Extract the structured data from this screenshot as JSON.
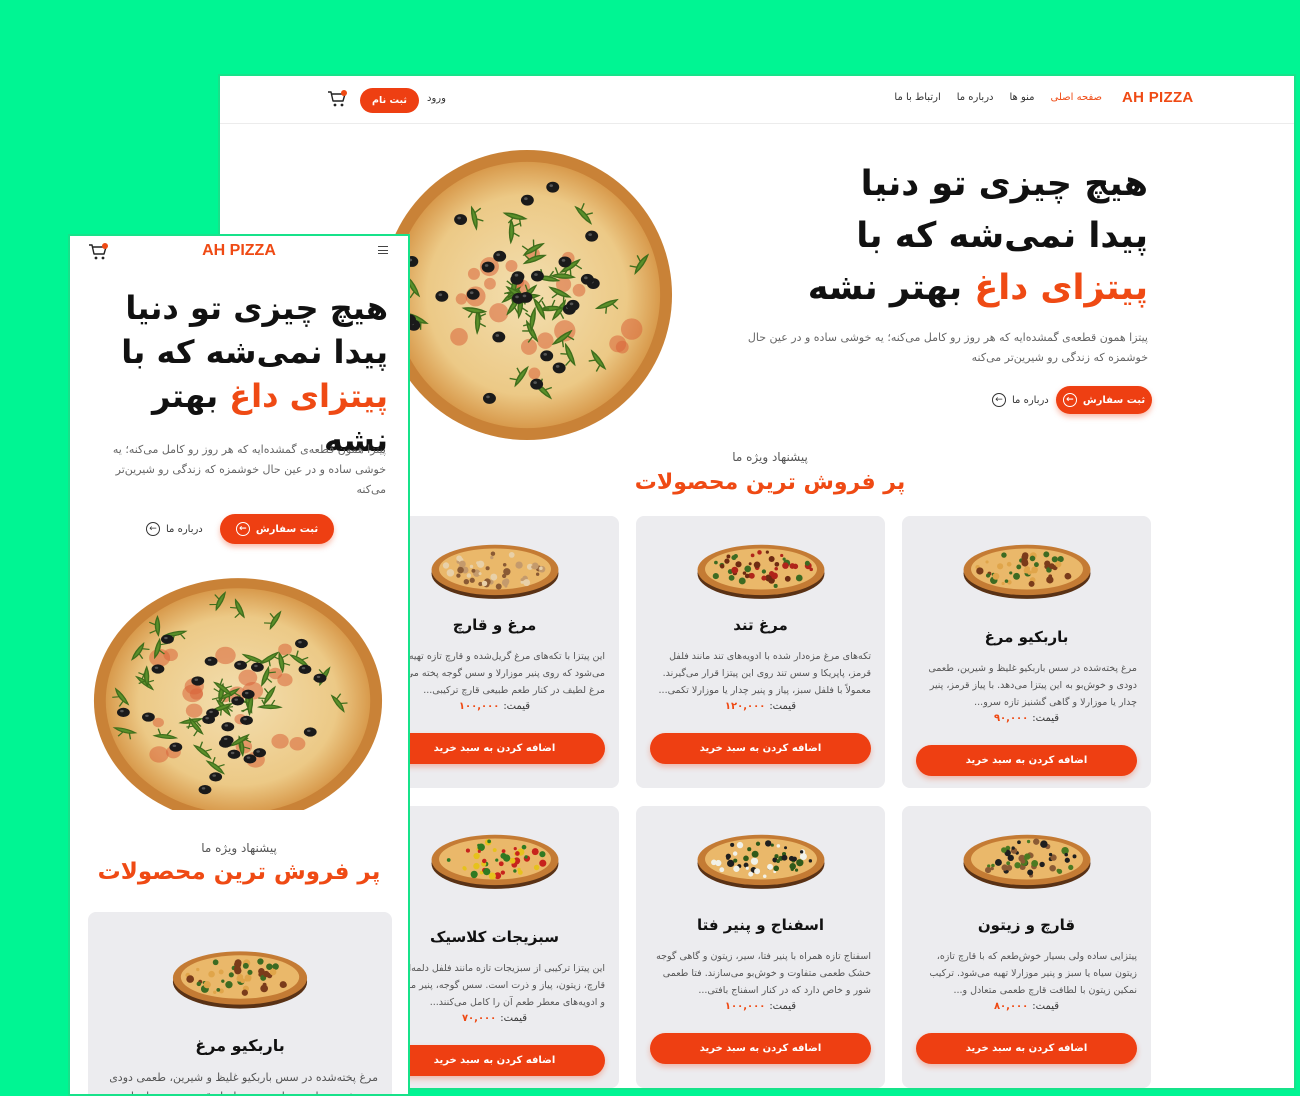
{
  "brand": "AH PIZZA",
  "colors": {
    "accent": "#ef4a14",
    "background": "#00f593",
    "card": "#ececef"
  },
  "nav": {
    "items": [
      "صفحه اصلی",
      "منو ها",
      "درباره ما",
      "ارتباط با ما"
    ],
    "login": "ورود",
    "signup": "ثبت نام",
    "cart_icon": "cart-icon"
  },
  "hero": {
    "title_line1": "هیچ چیزی تو دنیا",
    "title_line2": "پیدا نمی‌شه که با",
    "title_accent": "پیتزای داغ",
    "title_end": "بهتر نشه",
    "description": "پیتزا همون قطعه‌ی گمشده‌ایه که هر روز رو کامل می‌کنه؛ یه خوشی ساده و در عین حال خوشمزه که زندگی رو شیرین‌تر می‌کنه",
    "order_button": "ثبت سفارش",
    "about_button": "درباره ما"
  },
  "section": {
    "subtitle": "پیشنهاد ویژه ما",
    "title": "پر فروش ترین محصولات"
  },
  "price_label": "قیمت:",
  "add_to_cart": "اضافه کردن به سبد خرید",
  "products": [
    {
      "name": "باربکیو مرغ",
      "description": "مرغ پخته‌شده در سس باربکیو غلیظ و شیرین، طعمی دودی و خوش‌بو به این پیتزا می‌دهد. با پیاز قرمز، پنیر چدار یا موزارلا و گاهی گشنیز تازه سرو...",
      "price": "۹۰,۰۰۰"
    },
    {
      "name": "مرغ تند",
      "description": "تکه‌های مرغ مزه‌دار شده با ادویه‌های تند مانند فلفل قرمز، پاپریکا و سس تند روی این پیتزا قرار می‌گیرند. معمولاً با فلفل سبز، پیاز و پنیر چدار یا موزارلا تکمی...",
      "price": "۱۲۰,۰۰۰"
    },
    {
      "name": "مرغ و قارچ",
      "description": "این پیتزا با تکه‌های مرغ گریل‌شده و قارچ تازه تهیه می‌شود که روی پنیر موزارلا و سس گوجه پخته می‌شود. مرغ لطیف در کنار طعم طبیعی قارچ ترکیبی...",
      "price": "۱۰۰,۰۰۰"
    },
    {
      "name": "قارچ و زیتون",
      "description": "پیتزایی ساده ولی بسیار خوش‌طعم که با قارچ تازه، زیتون سیاه یا سبز و پنیر موزارلا تهیه می‌شود. ترکیب نمکین زیتون با لطافت قارچ طعمی متعادل و...",
      "price": "۸۰,۰۰۰"
    },
    {
      "name": "اسفناج و پنیر فتا",
      "description": "اسفناج تازه همراه با پنیر فتا، سیر، زیتون و گاهی گوجه خشک طعمی متفاوت و خوش‌بو می‌سازند. فتا طعمی شور و خاص دارد که در کنار اسفناج بافتی...",
      "price": "۱۰۰,۰۰۰"
    },
    {
      "name": "سبزیجات کلاسیک",
      "description": "این پیتزا ترکیبی از سبزیجات تازه مانند فلفل دلمه‌ای، قارچ، زیتون، پیاز و ذرت است. سس گوجه، پنیر موزارلا و ادویه‌های معطر طعم آن را کامل می‌کنند...",
      "price": "۷۰,۰۰۰"
    }
  ]
}
